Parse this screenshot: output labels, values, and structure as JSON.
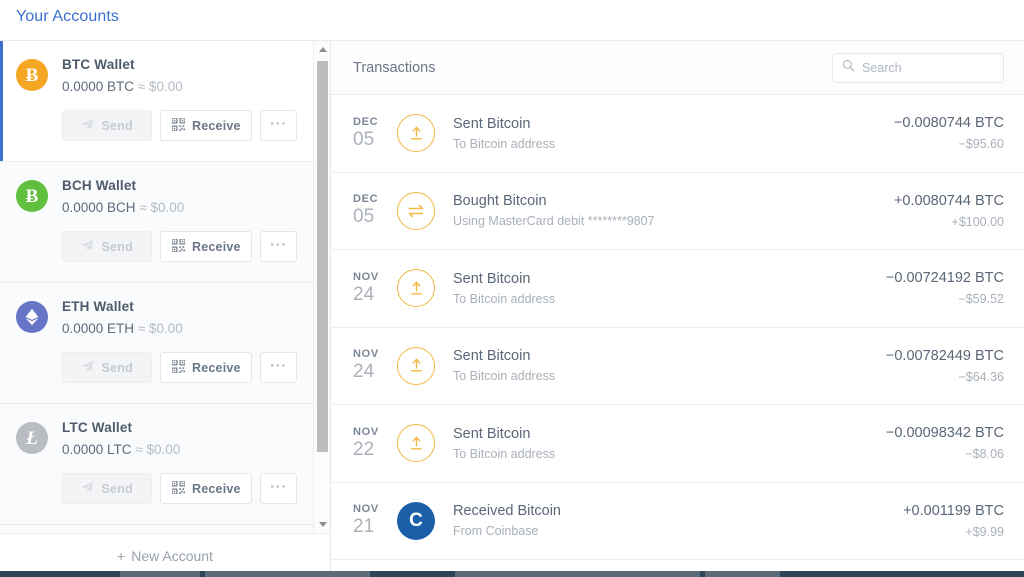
{
  "page_title": "Your Accounts",
  "accent_color": "#3d6fd0",
  "accounts_panel": {
    "new_account_label": "New Account",
    "new_account_plus": "+",
    "accounts": [
      {
        "name": "BTC Wallet",
        "balance": "0.0000 BTC",
        "approx": "≈",
        "fiat": "$0.00",
        "symbol": "BTC",
        "color": "#f5a623",
        "active": true,
        "send_label": "Send",
        "receive_label": "Receive",
        "more_label": "···"
      },
      {
        "name": "BCH Wallet",
        "balance": "0.0000 BCH",
        "approx": "≈",
        "fiat": "$0.00",
        "symbol": "BCH",
        "color": "#60bf3c",
        "active": false,
        "send_label": "Send",
        "receive_label": "Receive",
        "more_label": "···"
      },
      {
        "name": "ETH Wallet",
        "balance": "0.0000 ETH",
        "approx": "≈",
        "fiat": "$0.00",
        "symbol": "ETH",
        "color": "#6675c5",
        "active": false,
        "send_label": "Send",
        "receive_label": "Receive",
        "more_label": "···"
      },
      {
        "name": "LTC Wallet",
        "balance": "0.0000 LTC",
        "approx": "≈",
        "fiat": "$0.00",
        "symbol": "LTC",
        "color": "#b9bcc2",
        "active": false,
        "send_label": "Send",
        "receive_label": "Receive",
        "more_label": "···"
      }
    ]
  },
  "transactions_panel": {
    "title": "Transactions",
    "search": {
      "value": "",
      "placeholder": "Search"
    },
    "rows": [
      {
        "month": "DEC",
        "day": "05",
        "icon": "send-arrow-icon",
        "name": "Sent Bitcoin",
        "sub": "To Bitcoin address",
        "crypto": "−0.0080744 BTC",
        "fiat": "−$95.60"
      },
      {
        "month": "DEC",
        "day": "05",
        "icon": "exchange-arrows-icon",
        "name": "Bought Bitcoin",
        "sub": "Using MasterCard debit ********9807",
        "crypto": "+0.0080744 BTC",
        "fiat": "+$100.00"
      },
      {
        "month": "NOV",
        "day": "24",
        "icon": "send-arrow-icon",
        "name": "Sent Bitcoin",
        "sub": "To Bitcoin address",
        "crypto": "−0.00724192 BTC",
        "fiat": "−$59.52"
      },
      {
        "month": "NOV",
        "day": "24",
        "icon": "send-arrow-icon",
        "name": "Sent Bitcoin",
        "sub": "To Bitcoin address",
        "crypto": "−0.00782449 BTC",
        "fiat": "−$64.36"
      },
      {
        "month": "NOV",
        "day": "22",
        "icon": "send-arrow-icon",
        "name": "Sent Bitcoin",
        "sub": "To Bitcoin address",
        "crypto": "−0.00098342 BTC",
        "fiat": "−$8.06"
      },
      {
        "month": "NOV",
        "day": "21",
        "icon": "coinbase-logo-icon",
        "name": "Received Bitcoin",
        "sub": "From Coinbase",
        "crypto": "+0.001199 BTC",
        "fiat": "+$9.99"
      }
    ]
  }
}
